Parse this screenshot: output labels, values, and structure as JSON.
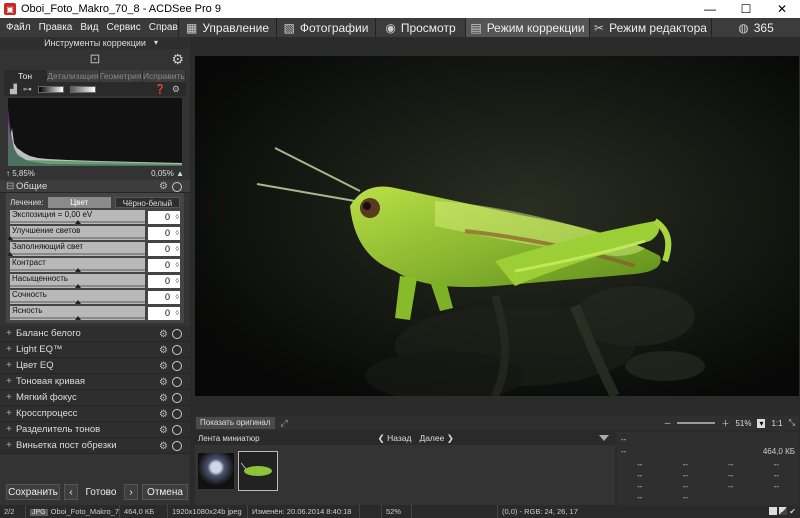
{
  "window": {
    "title": "Oboi_Foto_Makro_70_8 - ACDSee Pro 9"
  },
  "menu": {
    "items": [
      "Файл",
      "Правка",
      "Вид",
      "Сервис",
      "Справка"
    ]
  },
  "mode_tabs": [
    {
      "label": "Управление",
      "icon": "grid-icon"
    },
    {
      "label": "Фотографии",
      "icon": "photos-icon"
    },
    {
      "label": "Просмотр",
      "icon": "eye-icon"
    },
    {
      "label": "Режим коррекции",
      "icon": "develop-icon",
      "active": true
    },
    {
      "label": "Режим редактора",
      "icon": "edit-icon"
    },
    {
      "label": "365",
      "icon": "cloud-365-icon"
    }
  ],
  "left_panel": {
    "header": "Инструменты коррекции",
    "subtabs": [
      "Тон",
      "Детализация",
      "Геометрия",
      "Исправить"
    ],
    "hist_left": "5,85%",
    "hist_right": "0,05%",
    "general": {
      "title": "Общие",
      "treatment_label": "Лечение:",
      "treatment_color": "Цвет",
      "treatment_bw": "Чёрно-белый",
      "sliders": [
        {
          "label": "Экспозиция = 0,00 eV",
          "value": "0",
          "level": 0.5
        },
        {
          "label": "Улучшение светов",
          "value": "0",
          "level": 0.0
        },
        {
          "label": "Заполняющий свет",
          "value": "0",
          "level": 0.0
        },
        {
          "label": "Контраст",
          "value": "0",
          "level": 0.5
        },
        {
          "label": "Насыщенность",
          "value": "0",
          "level": 0.5
        },
        {
          "label": "Сочность",
          "value": "0",
          "level": 0.5
        },
        {
          "label": "Ясность",
          "value": "0",
          "level": 0.5
        }
      ]
    },
    "sections": [
      "Баланс белого",
      "Light EQ™",
      "Цвет EQ",
      "Тоновая кривая",
      "Мягкий фокус",
      "Кросспроцесс",
      "Разделитель тонов",
      "Виньетка пост обрезки"
    ],
    "buttons": {
      "save": "Сохранить",
      "done": "Готово",
      "cancel": "Отмена"
    }
  },
  "viewer": {
    "show_original": "Показать оригинал",
    "zoom": "51%",
    "ratio": "1:1"
  },
  "filmstrip": {
    "title": "Лента миниатюр",
    "back": "Назад",
    "forward": "Далее"
  },
  "info": {
    "top": "--",
    "line2_left": "--",
    "line2_right": "464,0 КБ",
    "cell": "--"
  },
  "status": {
    "count": "2/2",
    "type": "JPG",
    "filename": "Oboi_Foto_Makro_70_8",
    "size": "464,0 КБ",
    "dims": "1920x1080x24b jpeg",
    "modified": "Изменён: 20.06.2014 8:40:18",
    "zoom": "52%",
    "pixel": "(0,0) - RGB: 24, 26, 17"
  },
  "colors": {
    "accent": "#c62828",
    "panel": "#333333",
    "image_bg": "#0c0d0c"
  }
}
